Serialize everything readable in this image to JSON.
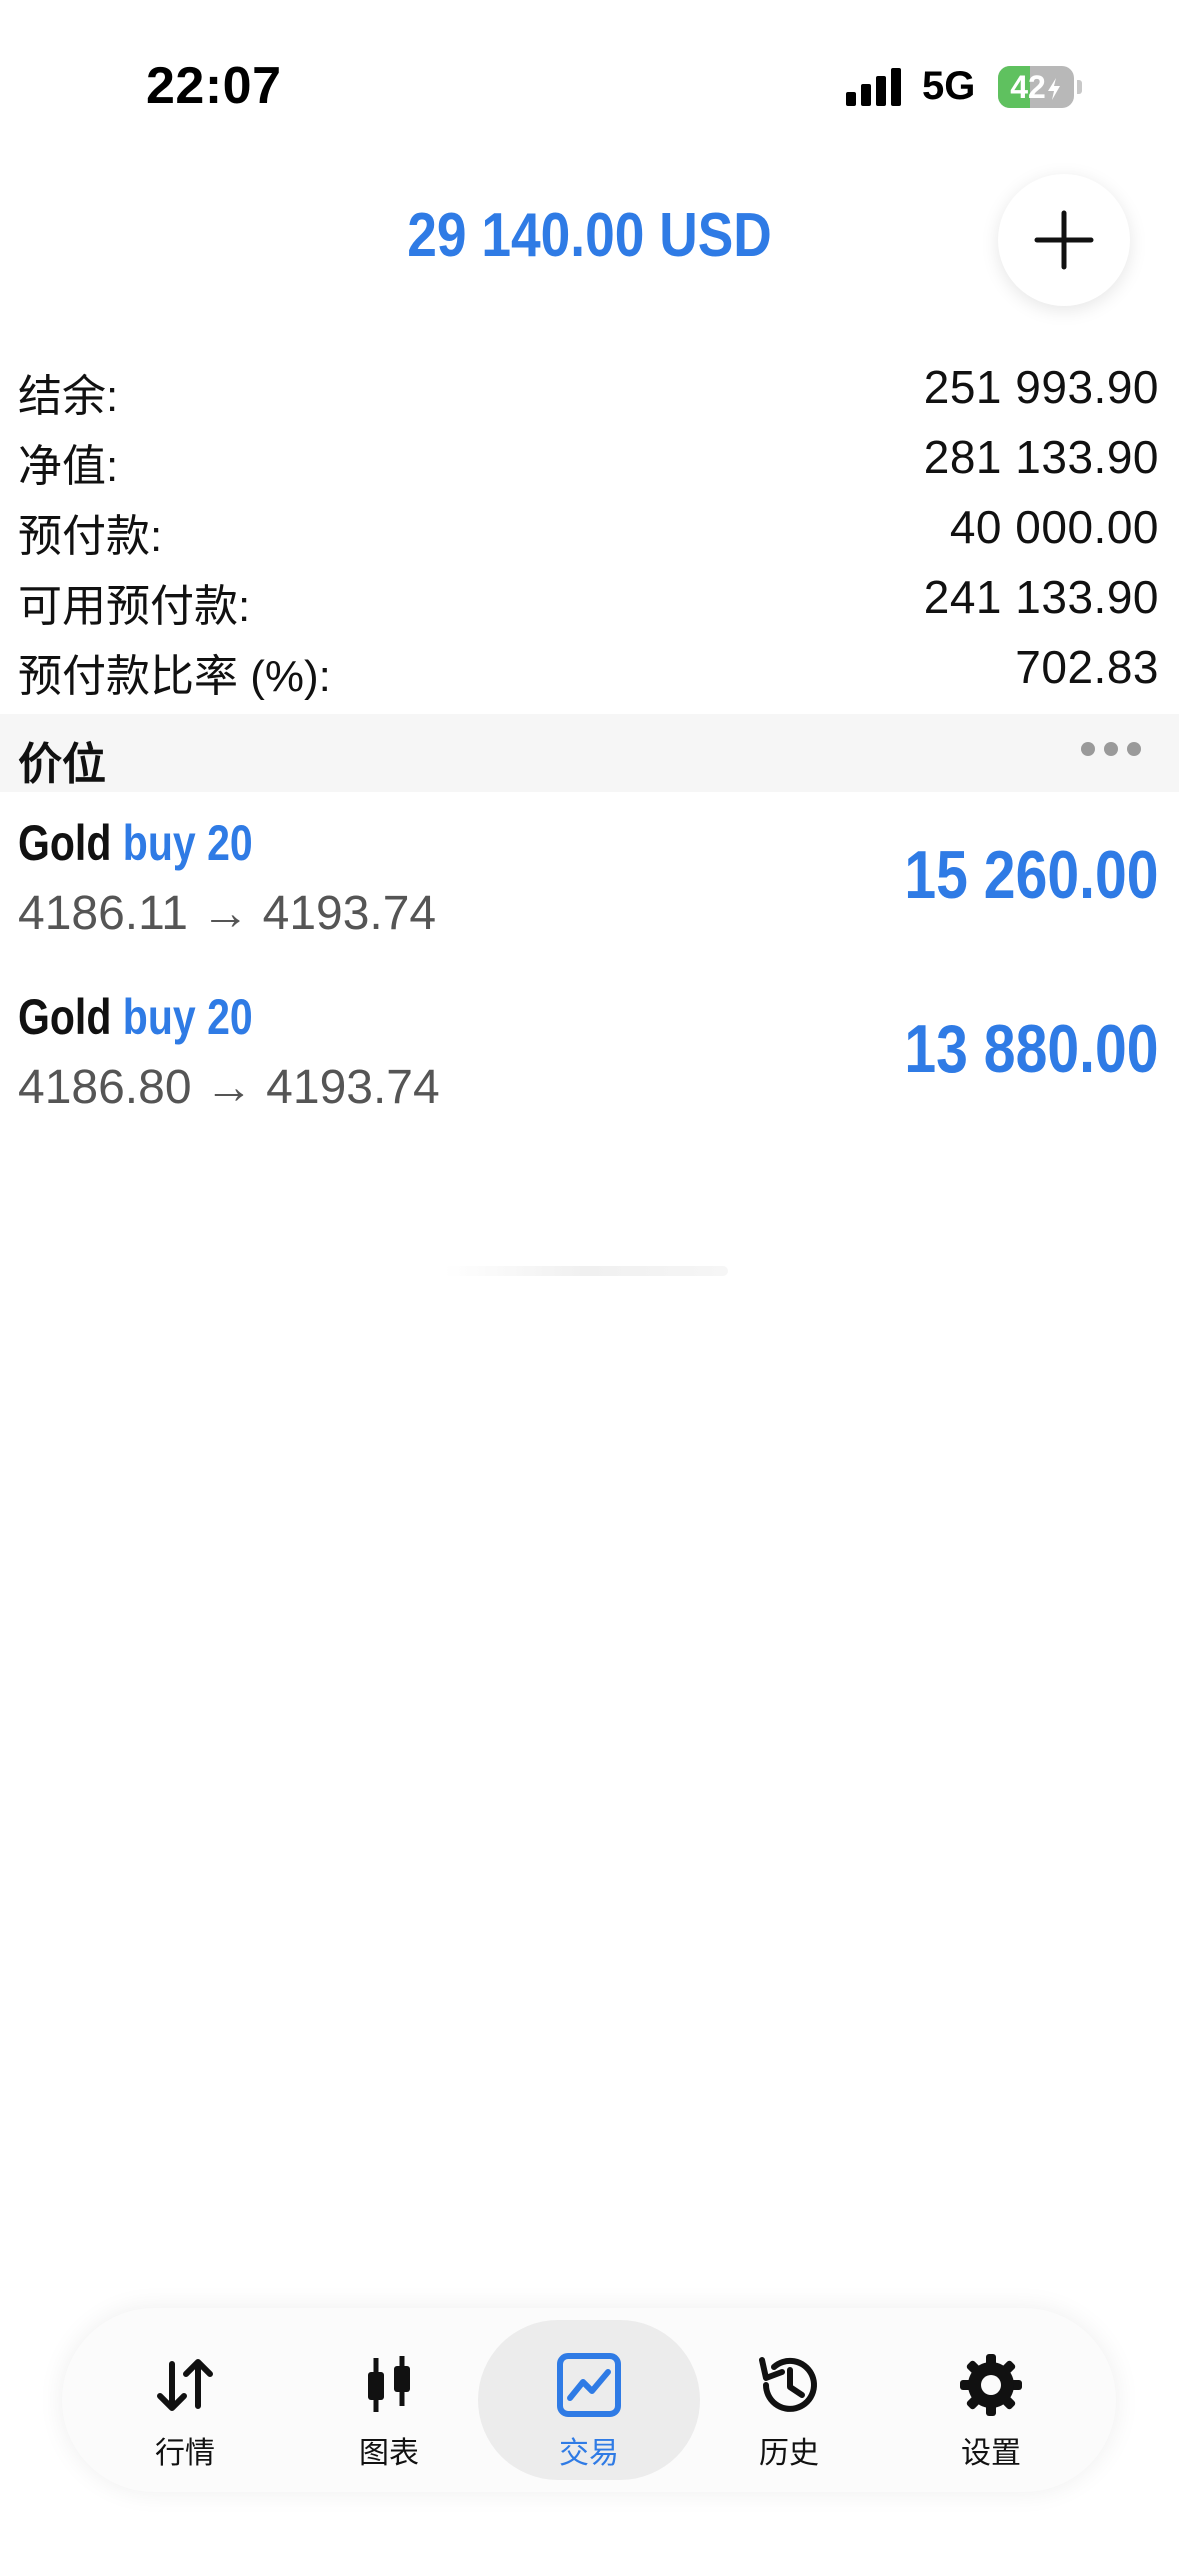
{
  "status_bar": {
    "time": "22:07",
    "network": "5G",
    "battery": "42",
    "battery_level": 0.42
  },
  "header": {
    "balance_title": "29 140.00 USD",
    "add_button_icon": "plus-icon"
  },
  "summary": [
    {
      "label": "结余:",
      "value": "251 993.90"
    },
    {
      "label": "净值:",
      "value": "281 133.90"
    },
    {
      "label": "预付款:",
      "value": "40 000.00"
    },
    {
      "label": "可用预付款:",
      "value": "241 133.90"
    },
    {
      "label": "预付款比率 (%):",
      "value": "702.83"
    }
  ],
  "positions_section": {
    "title": "价位",
    "more_icon": "more-dots-icon"
  },
  "positions": [
    {
      "symbol": "Gold",
      "type": "buy 20",
      "prices": "4186.11 → 4193.74",
      "profit": "15 260.00"
    },
    {
      "symbol": "Gold",
      "type": "buy 20",
      "prices": "4186.80 → 4193.74",
      "profit": "13 880.00"
    }
  ],
  "tab_bar": {
    "tabs": [
      {
        "label": "行情",
        "icon": "arrows-up-down-icon",
        "active": false
      },
      {
        "label": "图表",
        "icon": "candlestick-icon",
        "active": false
      },
      {
        "label": "交易",
        "icon": "trade-chart-icon",
        "active": true
      },
      {
        "label": "历史",
        "icon": "history-icon",
        "active": false
      },
      {
        "label": "设置",
        "icon": "gear-icon",
        "active": false
      }
    ]
  },
  "colors": {
    "accent": "#2f7be5",
    "battery_green": "#5fc15f"
  }
}
